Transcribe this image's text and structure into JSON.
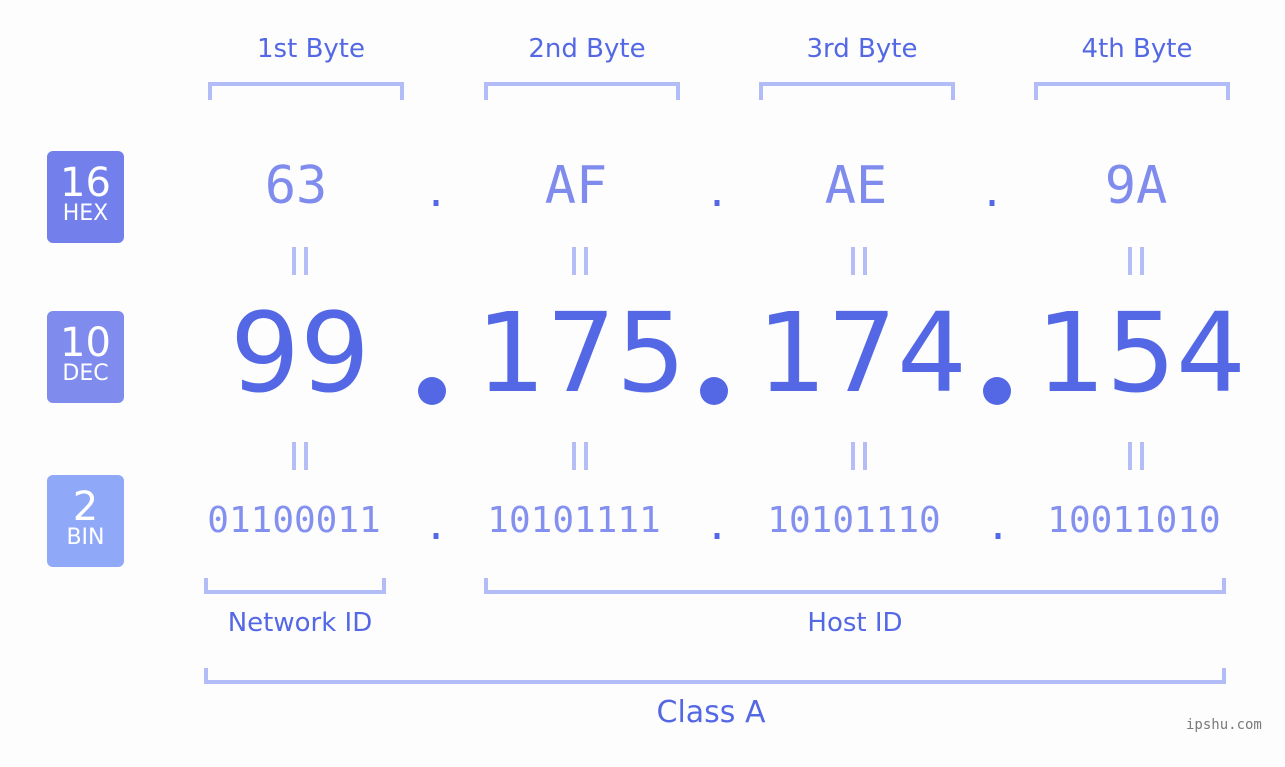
{
  "bytes": {
    "labels": [
      "1st Byte",
      "2nd Byte",
      "3rd Byte",
      "4th Byte"
    ]
  },
  "badges": {
    "hex": {
      "number": "16",
      "label": "HEX",
      "color": "#7380ec"
    },
    "dec": {
      "number": "10",
      "label": "DEC",
      "color": "#7f8cee"
    },
    "bin": {
      "number": "2",
      "label": "BIN",
      "color": "#8fa8f8"
    }
  },
  "ip": {
    "hex": [
      "63",
      "AF",
      "AE",
      "9A"
    ],
    "dec": [
      "99",
      "175",
      "174",
      "154"
    ],
    "bin": [
      "01100011",
      "10101111",
      "10101110",
      "10011010"
    ],
    "separator": "."
  },
  "segments": {
    "network": "Network ID",
    "host": "Host ID",
    "class": "Class A"
  },
  "watermark": "ipshu.com",
  "colors": {
    "accent": "#5468e6",
    "bracket": "#b2bcf7",
    "background": "#fcfdfc"
  }
}
